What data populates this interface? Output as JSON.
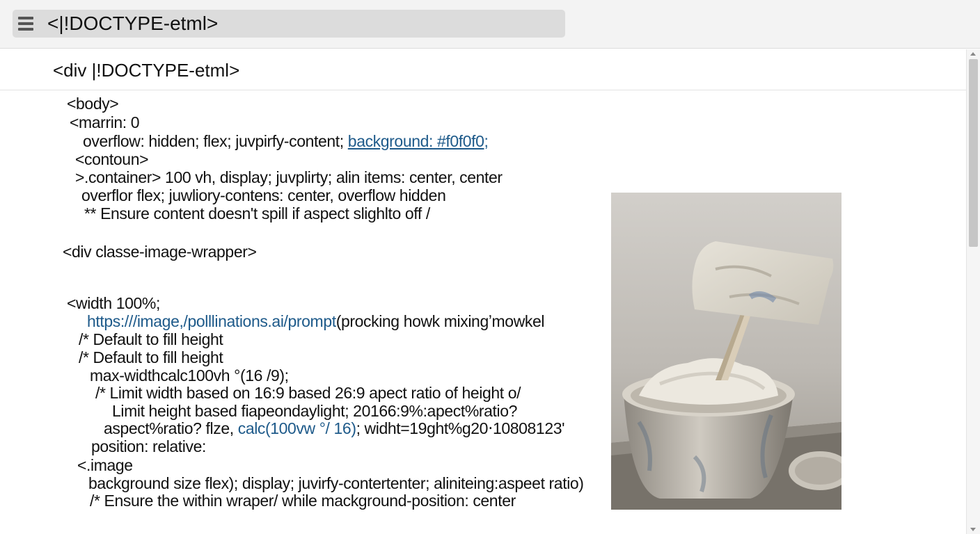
{
  "address_bar": {
    "text": "<|!DOCTYPE-etml>"
  },
  "heading": {
    "text": "<div |!DOCTYPE-etml>"
  },
  "code_lines": [
    "<body>",
    "<marrin: 0",
    "overflow: hidden; flex; juvpirfy-content; ",
    "background: #f0f0f0;",
    "<contoun>",
    ">.container> 100 vh, display; juvplirty; alin items: center, center",
    "overflor flex; juwliory-contens: center, overflow hidden",
    "** Ensure content doesn't spill if aspect slighlto off /",
    "<div classe-image-wrapper>",
    "<width  100%;",
    "https:///image,/polllinations.ai/prompt",
    "(procking howk mixingʼmowkel",
    "/* Default to fill height",
    "/* Default to fill height",
    "max-widthcalc100vh °(16 /9);",
    "/* Limit width based on 16:9 based 26:9 apect  ratio of height  o/",
    "Limit height based fiapeondaylight; 20166:9%:apect%ratio?",
    "aspect%ratio? flze, ",
    "calc(100vw °/ 16)",
    "; widht=19ght%g20‧10808123'",
    "position: relative:",
    "<.image",
    "background size flex); display; juvirfy-contertenter; aliniteing:aspeet ratio)",
    "/* Ensure the within wraper/ while mackground-position: center"
  ],
  "image": {
    "subject": "plaster-bucket-with-trowel"
  },
  "colors": {
    "link": "#1e5a8a",
    "topbar": "#f3f3f3",
    "address_bar": "#dcdcdc"
  }
}
